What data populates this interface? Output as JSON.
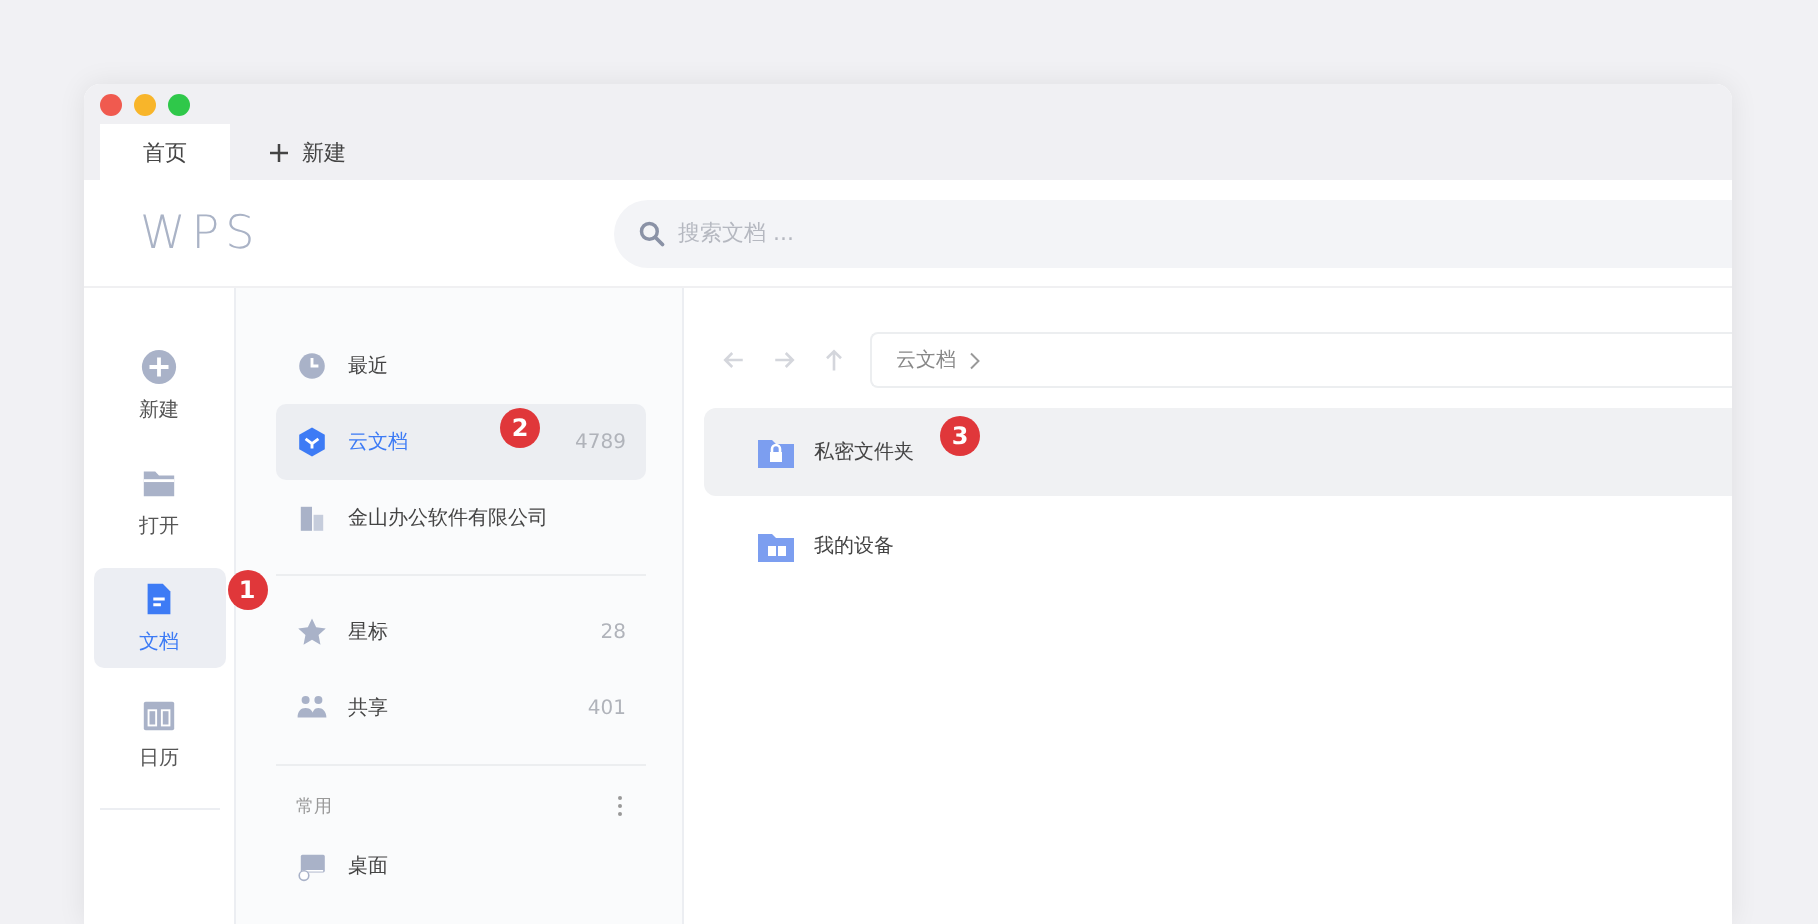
{
  "tabs": [
    {
      "label": "首页",
      "selected": true
    },
    {
      "label": "新建",
      "selected": false,
      "kind": "new"
    }
  ],
  "header": {
    "logo": "WPS",
    "search": {
      "placeholder": "搜索文档 ..."
    }
  },
  "rail": [
    {
      "label": "新建",
      "kind": "plus",
      "selected": false
    },
    {
      "label": "打开",
      "kind": "folder",
      "selected": false
    },
    {
      "label": "文档",
      "kind": "doc",
      "selected": true,
      "callout": "1"
    },
    {
      "label": "日历",
      "kind": "calendar",
      "selected": false
    }
  ],
  "side_panel": {
    "groups": [
      {
        "items": [
          {
            "label": "最近",
            "kind": "clock",
            "selected": false
          },
          {
            "label": "云文档",
            "kind": "cloud",
            "count": "4789",
            "selected": true,
            "callout": "2"
          },
          {
            "label": "金山办公软件有限公司",
            "kind": "building",
            "selected": false
          }
        ]
      },
      {
        "items": [
          {
            "label": "星标",
            "kind": "star",
            "count": "28",
            "selected": false
          },
          {
            "label": "共享",
            "kind": "people",
            "count": "401",
            "selected": false
          }
        ]
      },
      {
        "heading": "常用",
        "items": [
          {
            "label": "桌面",
            "kind": "desktop",
            "selected": false
          }
        ]
      }
    ]
  },
  "main": {
    "breadcrumb": [
      "云文档"
    ],
    "rows": [
      {
        "label": "私密文件夹",
        "kind": "locked",
        "selected": true,
        "callout": "3"
      },
      {
        "label": "我的设备",
        "kind": "device",
        "selected": false
      }
    ]
  }
}
